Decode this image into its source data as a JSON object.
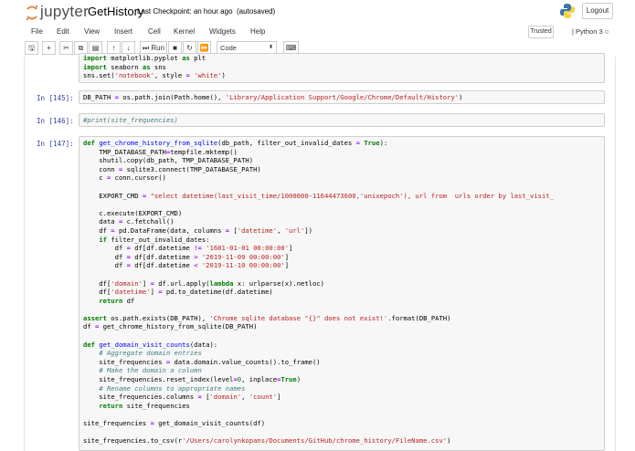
{
  "header": {
    "logo_text": "jupyter",
    "notebook_name": "GetHistory",
    "checkpoint": "Last Checkpoint: an hour ago",
    "autosave": "(autosaved)",
    "logout_label": "Logout"
  },
  "menubar": {
    "items": [
      "File",
      "Edit",
      "View",
      "Insert",
      "Cell",
      "Kernel",
      "Widgets",
      "Help"
    ],
    "trusted": "Trusted",
    "kernel": "Python 3"
  },
  "toolbar": {
    "run_label": "Run",
    "cell_type": "Code"
  },
  "cells": {
    "c0": {
      "lines": [
        "import matplotlib.pyplot as plt",
        "import seaborn as sns",
        "sns.set('notebook', style = 'white')"
      ]
    },
    "c145": {
      "prompt": "In [145]:",
      "lines": [
        "DB_PATH = os.path.join(Path.home(), 'Library/Application Support/Google/Chrome/Default/History')"
      ]
    },
    "c146": {
      "prompt": "In [146]:",
      "lines": [
        "#print(site_frequencies)"
      ]
    },
    "c147": {
      "prompt": "In [147]:",
      "lines": [
        "def get_chrome_history_from_sqlite(db_path, filter_out_invalid_dates = True):",
        "    TMP_DATABASE_PATH=tempfile.mktemp()",
        "    shutil.copy(db_path, TMP_DATABASE_PATH)",
        "    conn = sqlite3.connect(TMP_DATABASE_PATH)",
        "    c = conn.cursor()",
        "",
        "    EXPORT_CMD = \"select datetime(last_visit_time/1000000-11644473600,'unixepoch'), url from  urls order by last_visit_",
        "",
        "    c.execute(EXPORT_CMD)",
        "    data = c.fetchall()",
        "    df = pd.DataFrame(data, columns = ['datetime', 'url'])",
        "    if filter_out_invalid_dates:",
        "        df = df[df.datetime != '1601-01-01 00:00:00']",
        "        df = df[df.datetime > '2019-11-09 00:00:00']",
        "        df = df[df.datetime < '2019-11-10 00:00:00']",
        "",
        "    df['domain'] = df.url.apply(lambda x: urlparse(x).netloc)",
        "    df['datetime'] = pd.to_datetime(df.datetime)",
        "    return df",
        "",
        "assert os.path.exists(DB_PATH), 'Chrome sqlite database \"{}\" does not exist!'.format(DB_PATH)",
        "df = get_chrome_history_from_sqlite(DB_PATH)",
        "",
        "def get_domain_visit_counts(data):",
        "    # Aggregate domain entries",
        "    site_frequencies = data.domain.value_counts().to_frame()",
        "    # Make the domain a column",
        "    site_frequencies.reset_index(level=0, inplace=True)",
        "    # Rename columns to appropriate names",
        "    site_frequencies.columns = ['domain', 'count']",
        "    return site_frequencies",
        "",
        "site_frequencies = get_domain_visit_counts(df)",
        "",
        "site_frequencies.to_csv(r'/Users/carolynkopans/Documents/GitHub/chrome_history/FileName.csv')"
      ]
    }
  },
  "colors": {
    "prompt": "#303f9f",
    "keyword": "#008000",
    "string": "#ba2121",
    "comment": "#408080",
    "function": "#0000ff",
    "cell_bg": "#f7f7f7"
  }
}
